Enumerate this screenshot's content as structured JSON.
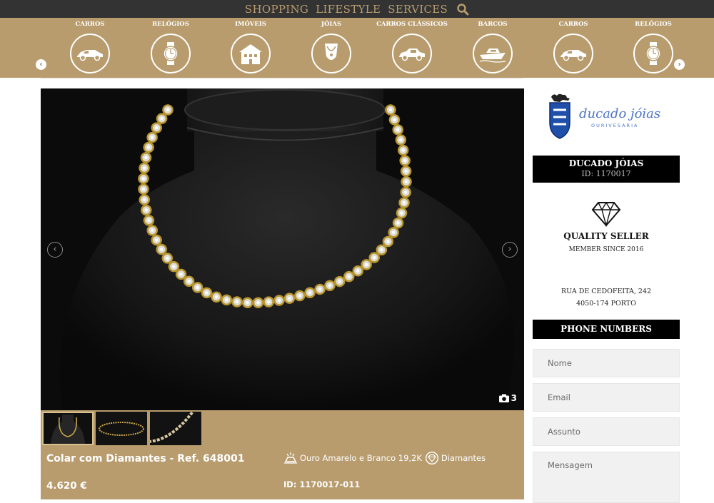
{
  "topnav": {
    "items": [
      "SHOPPING",
      "LIFESTYLE",
      "SERVICES"
    ]
  },
  "categories": [
    {
      "label": "CARROS",
      "icon": "car-icon"
    },
    {
      "label": "RELÓGIOS",
      "icon": "watch-icon"
    },
    {
      "label": "IMÓVEIS",
      "icon": "house-icon"
    },
    {
      "label": "JÓIAS",
      "icon": "necklace-icon"
    },
    {
      "label": "CARROS CLÁSSICOS",
      "icon": "classic-car-icon"
    },
    {
      "label": "BARCOS",
      "icon": "boat-icon"
    },
    {
      "label": "CARROS",
      "icon": "car-icon"
    },
    {
      "label": "RELÓGIOS",
      "icon": "watch-icon"
    }
  ],
  "gallery": {
    "photo_count": "3"
  },
  "product": {
    "title": "Colar com Diamantes - Ref. 648001",
    "price": "4.620 €",
    "material": "Ouro Amarelo e Branco 19,2K",
    "stone": "Diamantes",
    "id": "ID: 1170017-011"
  },
  "seller": {
    "logo_text": "ducado jóias",
    "logo_subtext": "OURIVESARIA",
    "name": "DUCADO JÓIAS",
    "id": "ID: 1170017",
    "badge": "QUALITY SELLER",
    "member_since": "MEMBER SINCE 2016",
    "address_line1": "RUA DE CEDOFEITA, 242",
    "address_line2": "4050-174 PORTO",
    "phone_label": "PHONE NUMBERS"
  },
  "form": {
    "name_placeholder": "Nome",
    "email_placeholder": "Email",
    "subject_placeholder": "Assunto",
    "message_placeholder": "Mensagem"
  },
  "colors": {
    "gold": "#b89c6e",
    "topbar": "#333333",
    "black": "#000000"
  }
}
